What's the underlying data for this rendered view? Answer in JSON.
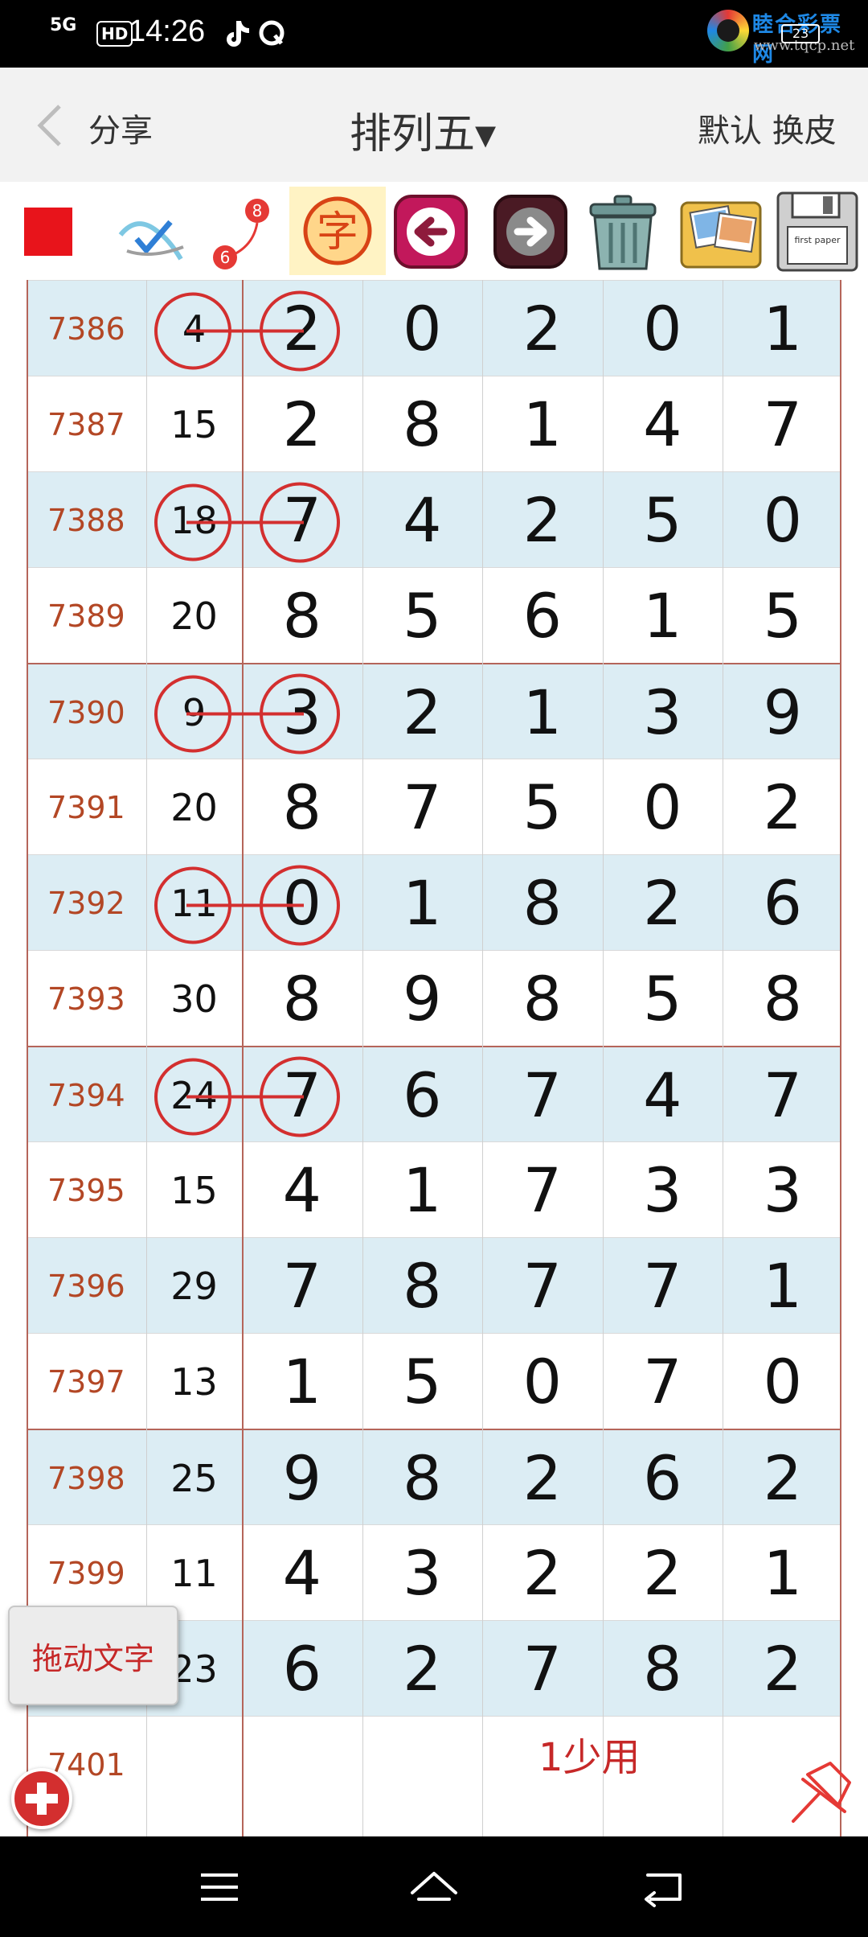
{
  "status_bar": {
    "network": "5G",
    "hd": "HD",
    "time": "14:26",
    "watermark_name": "睦合彩票网",
    "watermark_url": "www.tqcp.net",
    "battery": "23"
  },
  "header": {
    "share_label": "分享",
    "title": "排列五▾",
    "right_label": "默认 换皮"
  },
  "toolbar": {
    "items": [
      "color-swatch",
      "eraser",
      "number-path",
      "text",
      "back-arrow",
      "forward-arrow",
      "trash",
      "pictures",
      "save-disk"
    ],
    "text_tool_glyph": "字",
    "path_start": "6",
    "path_end": "8",
    "disk_label": "first paper"
  },
  "table": {
    "rows": [
      {
        "id": "7386",
        "sum": "4",
        "d": [
          "2",
          "0",
          "2",
          "0",
          "1"
        ]
      },
      {
        "id": "7387",
        "sum": "15",
        "d": [
          "2",
          "8",
          "1",
          "4",
          "7"
        ]
      },
      {
        "id": "7388",
        "sum": "18",
        "d": [
          "7",
          "4",
          "2",
          "5",
          "0"
        ]
      },
      {
        "id": "7389",
        "sum": "20",
        "d": [
          "8",
          "5",
          "6",
          "1",
          "5"
        ]
      },
      {
        "id": "7390",
        "sum": "9",
        "d": [
          "3",
          "2",
          "1",
          "3",
          "9"
        ]
      },
      {
        "id": "7391",
        "sum": "20",
        "d": [
          "8",
          "7",
          "5",
          "0",
          "2"
        ]
      },
      {
        "id": "7392",
        "sum": "11",
        "d": [
          "0",
          "1",
          "8",
          "2",
          "6"
        ]
      },
      {
        "id": "7393",
        "sum": "30",
        "d": [
          "8",
          "9",
          "8",
          "5",
          "8"
        ]
      },
      {
        "id": "7394",
        "sum": "24",
        "d": [
          "7",
          "6",
          "7",
          "4",
          "7"
        ]
      },
      {
        "id": "7395",
        "sum": "15",
        "d": [
          "4",
          "1",
          "7",
          "3",
          "3"
        ]
      },
      {
        "id": "7396",
        "sum": "29",
        "d": [
          "7",
          "8",
          "7",
          "7",
          "1"
        ]
      },
      {
        "id": "7397",
        "sum": "13",
        "d": [
          "1",
          "5",
          "0",
          "7",
          "0"
        ]
      },
      {
        "id": "7398",
        "sum": "25",
        "d": [
          "9",
          "8",
          "2",
          "6",
          "2"
        ]
      },
      {
        "id": "7399",
        "sum": "11",
        "d": [
          "4",
          "3",
          "2",
          "2",
          "1"
        ]
      },
      {
        "id": "",
        "sum": "23",
        "d": [
          "6",
          "2",
          "7",
          "8",
          "2"
        ]
      },
      {
        "id": "7401",
        "sum": "",
        "d": [
          "",
          "",
          "",
          "",
          ""
        ]
      }
    ],
    "note": "1少用"
  },
  "overlay": {
    "drag_text_button": "拖动文字"
  },
  "colors": {
    "row_blue": "#dcedf4",
    "id_text": "#b34725",
    "annotation_red": "#d32f2f",
    "group_line": "#b5655a"
  }
}
